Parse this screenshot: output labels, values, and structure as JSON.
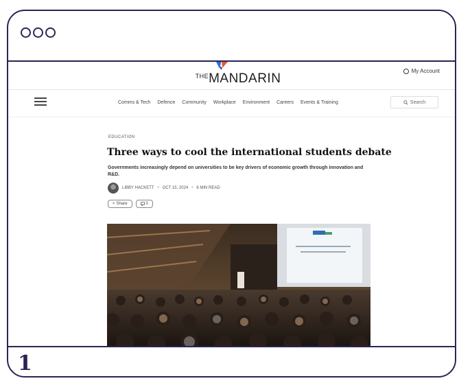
{
  "step": {
    "number": "1"
  },
  "site": {
    "logo_prefix": "THE",
    "logo_name": "MANDARIN",
    "account_label": "My Account",
    "nav": [
      "Comms & Tech",
      "Defence",
      "Community",
      "Workplace",
      "Environment",
      "Careers",
      "Events & Training"
    ],
    "search_label": "Search"
  },
  "article": {
    "category": "EDUCATION",
    "headline": "Three ways to cool the international students debate",
    "standfirst": "Governments increasingly depend on universities to be key drivers of economic growth through innovation and R&D.",
    "author": "LIBBY HACKETT",
    "date": "OCT 15, 2024",
    "read_time": "6 MIN READ",
    "share_label": "Share",
    "comments_count": "0"
  },
  "colors": {
    "frame": "#2a2456",
    "logo_blue": "#2f6fd6",
    "logo_orange": "#e8562a"
  },
  "icons": [
    "hamburger-icon",
    "search-icon",
    "account-icon",
    "share-icon",
    "comment-icon"
  ]
}
